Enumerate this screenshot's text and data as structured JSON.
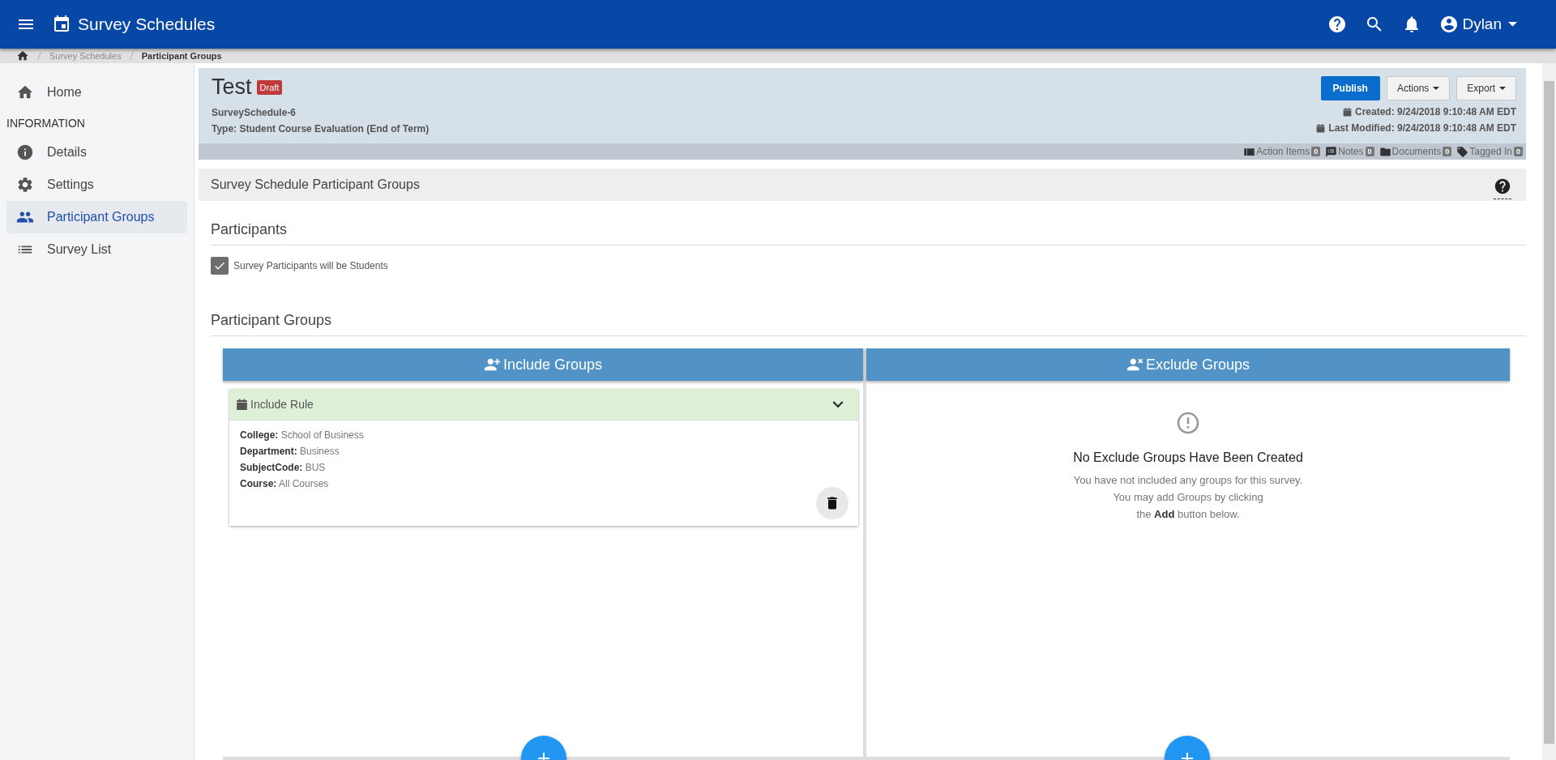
{
  "header": {
    "title": "Survey Schedules",
    "user": "Dylan"
  },
  "breadcrumb": [
    "Survey Schedules",
    "Participant Groups"
  ],
  "sidebar": {
    "top_items": [
      {
        "label": "Home",
        "selected": false
      }
    ],
    "section_title": "INFORMATION",
    "items": [
      {
        "label": "Details",
        "selected": false
      },
      {
        "label": "Settings",
        "selected": false
      },
      {
        "label": "Participant Groups",
        "selected": true
      },
      {
        "label": "Survey List",
        "selected": false
      }
    ]
  },
  "record": {
    "title": "Test",
    "status": "Draft",
    "id": "SurveySchedule-6",
    "type": "Type: Student Course Evaluation (End of Term)",
    "buttons": [
      {
        "label": "Publish",
        "kind": "primary"
      },
      {
        "label": "Actions",
        "kind": "dropdown"
      },
      {
        "label": "Export",
        "kind": "dropdown"
      }
    ],
    "created": "Created: 9/24/2018 9:10:48 AM EDT",
    "modified": "Last Modified: 9/24/2018 9:10:48 AM EDT",
    "counters": [
      {
        "label": "Action Items",
        "count": "0"
      },
      {
        "label": "Notes",
        "count": "0"
      },
      {
        "label": "Documents",
        "count": "0"
      },
      {
        "label": "Tagged In",
        "count": "0"
      }
    ]
  },
  "section_title": "Survey Schedule Participant Groups",
  "participants": {
    "heading": "Participants",
    "checkbox": {
      "label": "Survey Participants will be Students",
      "checked": true
    }
  },
  "groups": {
    "heading": "Participant Groups",
    "include": {
      "title": "Include Groups",
      "rules": [
        {
          "title": "Include Rule",
          "expanded": true,
          "fields": [
            {
              "label": "College:",
              "value": "School of Business"
            },
            {
              "label": "Department:",
              "value": "Business"
            },
            {
              "label": "SubjectCode:",
              "value": "BUS"
            },
            {
              "label": "Course:",
              "value": "All Courses"
            }
          ]
        }
      ]
    },
    "exclude": {
      "title": "Exclude Groups",
      "empty_title": "No Exclude Groups Have Been Created",
      "empty_message": "You have not included any groups for this survey.\nYou may add Groups by clicking\nthe **Add** button below."
    }
  }
}
